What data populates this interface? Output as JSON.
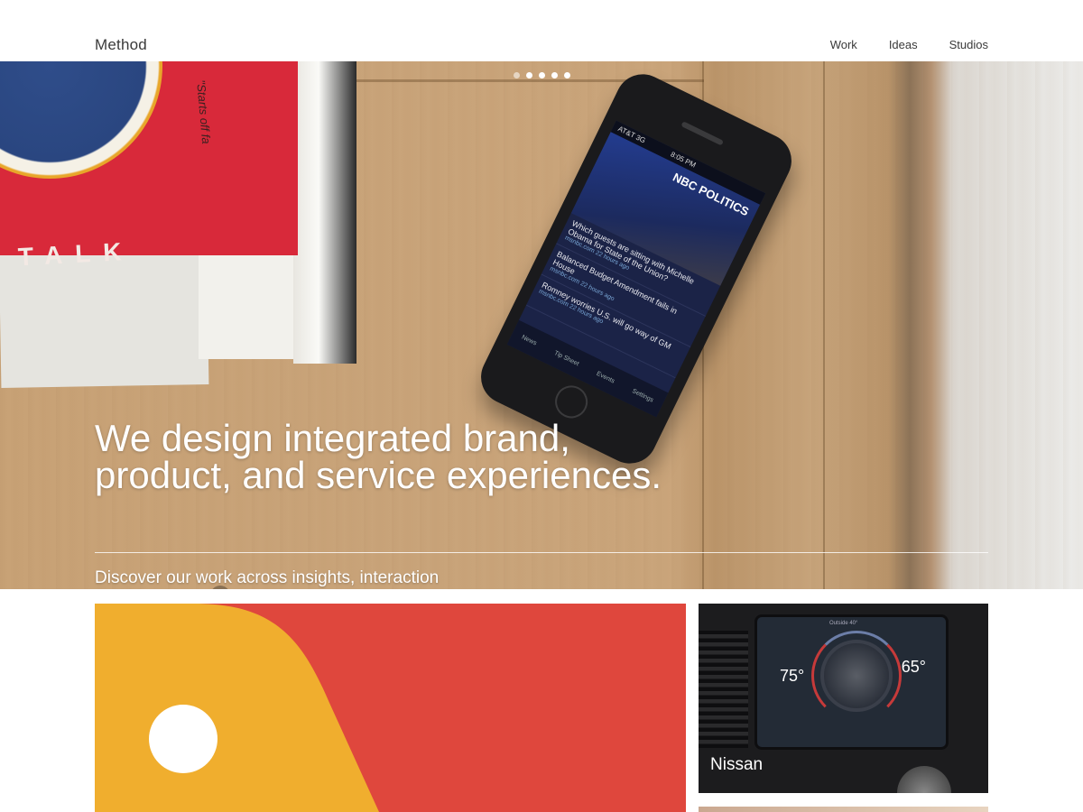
{
  "header": {
    "logo": "Method",
    "nav": [
      {
        "label": "Work"
      },
      {
        "label": "Ideas"
      },
      {
        "label": "Studios"
      }
    ]
  },
  "hero": {
    "slide_count": 5,
    "active_slide": 1,
    "headline": "We design integrated brand, product, and service experiences.",
    "subline": "Discover our work across insights, interaction and identities.",
    "phone_screen": {
      "carrier": "AT&T 3G",
      "time": "8:05 PM",
      "brand": "NBC POLITICS",
      "stories": [
        {
          "title": "Which guests are sitting with Michelle Obama for State of the Union?",
          "meta": "msnbc.com 22 hours ago"
        },
        {
          "title": "Balanced Budget Amendment fails in House",
          "meta": "msnbc.com 22 hours ago"
        },
        {
          "title": "Romney worries U.S. will go way of GM",
          "meta": "msnbc.com 22 hours ago"
        }
      ],
      "tabs": [
        "News",
        "Tip Sheet",
        "Events",
        "Settings"
      ]
    },
    "book_title": "TALK",
    "book_quote": "\"Starts off fa"
  },
  "tiles": [
    {
      "label": ""
    },
    {
      "label": "Nissan",
      "dash": {
        "outside": "Outside 40°",
        "driver_temp": "75°",
        "passenger_temp": "65°"
      }
    }
  ],
  "colors": {
    "tile_red": "#df473d",
    "tile_yellow": "#f0ae2e"
  }
}
